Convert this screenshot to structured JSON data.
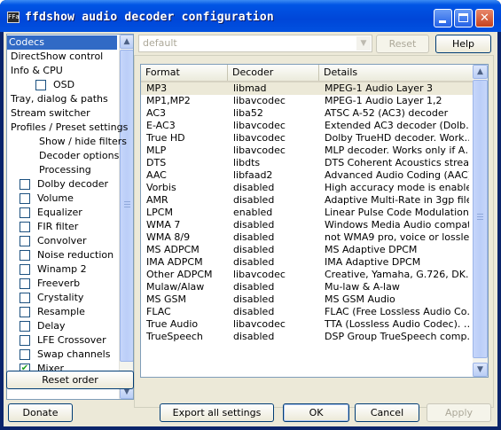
{
  "window": {
    "title": "ffdshow audio decoder configuration",
    "icon_text": "FFa"
  },
  "tree": {
    "items": [
      {
        "label": "Codecs",
        "checkbox": null,
        "selected": true
      },
      {
        "label": "DirectShow control",
        "checkbox": null
      },
      {
        "label": "Info & CPU",
        "checkbox": null
      },
      {
        "label": "OSD",
        "checkbox": false,
        "indent": 1
      },
      {
        "label": "Tray, dialog & paths",
        "checkbox": null
      },
      {
        "label": "Stream switcher",
        "checkbox": null
      },
      {
        "label": "Profiles / Preset settings",
        "checkbox": null
      },
      {
        "label": "Show / hide filters",
        "checkbox": null,
        "indent": 2
      },
      {
        "label": "Decoder options",
        "checkbox": null,
        "indent": 2
      },
      {
        "label": "Processing",
        "checkbox": null,
        "indent": 2
      },
      {
        "label": "Dolby decoder",
        "checkbox": false
      },
      {
        "label": "Volume",
        "checkbox": false
      },
      {
        "label": "Equalizer",
        "checkbox": false
      },
      {
        "label": "FIR filter",
        "checkbox": false
      },
      {
        "label": "Convolver",
        "checkbox": false
      },
      {
        "label": "Noise reduction",
        "checkbox": false
      },
      {
        "label": "Winamp 2",
        "checkbox": false
      },
      {
        "label": "Freeverb",
        "checkbox": false
      },
      {
        "label": "Crystality",
        "checkbox": false
      },
      {
        "label": "Resample",
        "checkbox": false
      },
      {
        "label": "Delay",
        "checkbox": false
      },
      {
        "label": "LFE Crossover",
        "checkbox": false
      },
      {
        "label": "Swap channels",
        "checkbox": false
      },
      {
        "label": "Mixer",
        "checkbox": true
      }
    ]
  },
  "preset": {
    "value": "default",
    "reset_label": "Reset",
    "help_label": "Help"
  },
  "codecs": {
    "columns": [
      "Format",
      "Decoder",
      "Details"
    ],
    "rows": [
      [
        "MP3",
        "libmad",
        "MPEG-1 Audio Layer 3"
      ],
      [
        "MP1,MP2",
        "libavcodec",
        "MPEG-1 Audio Layer 1,2"
      ],
      [
        "AC3",
        "liba52",
        "ATSC A-52 (AC3) decoder"
      ],
      [
        "E-AC3",
        "libavcodec",
        "Extended AC3 decoder (Dolb…"
      ],
      [
        "True HD",
        "libavcodec",
        "Dolby TrueHD decoder. Work…"
      ],
      [
        "MLP",
        "libavcodec",
        "MLP decoder. Works only if A…"
      ],
      [
        "DTS",
        "libdts",
        "DTS Coherent Acoustics strea…"
      ],
      [
        "AAC",
        "libfaad2",
        "Advanced Audio Coding (AAC)"
      ],
      [
        "Vorbis",
        "disabled",
        "High accuracy mode is enable…"
      ],
      [
        "AMR",
        "disabled",
        "Adaptive Multi-Rate in 3gp file…"
      ],
      [
        "LPCM",
        "enabled",
        "Linear Pulse Code Modulation"
      ],
      [
        "WMA 7",
        "disabled",
        "Windows Media Audio compati…"
      ],
      [
        "WMA 8/9",
        "disabled",
        "not WMA9 pro, voice or lossless"
      ],
      [
        "MS ADPCM",
        "disabled",
        "MS Adaptive DPCM"
      ],
      [
        "IMA ADPCM",
        "disabled",
        "IMA Adaptive DPCM"
      ],
      [
        "Other ADPCM",
        "libavcodec",
        "Creative, Yamaha, G.726, DK…"
      ],
      [
        "Mulaw/Alaw",
        "disabled",
        "Mu-law & A-law"
      ],
      [
        "MS GSM",
        "disabled",
        "MS GSM Audio"
      ],
      [
        "FLAC",
        "disabled",
        "FLAC (Free Lossless Audio Co…"
      ],
      [
        "True Audio",
        "libavcodec",
        "TTA (Lossless Audio Codec). …"
      ],
      [
        "TrueSpeech",
        "disabled",
        "DSP Group TrueSpeech comp…"
      ]
    ]
  },
  "buttons": {
    "reset_order": "Reset order",
    "donate": "Donate",
    "export": "Export all settings",
    "ok": "OK",
    "cancel": "Cancel",
    "apply": "Apply"
  },
  "icons": {
    "minimize": "minimize-icon",
    "maximize": "maximize-icon",
    "close": "close-icon",
    "scroll_up": "chevron-up-icon",
    "scroll_down": "chevron-down-icon",
    "checkmark": "check-icon"
  },
  "colors": {
    "titlebar": "#0055e5",
    "selection": "#316ac5",
    "face": "#ece9d8",
    "close_button": "#c6421d"
  }
}
